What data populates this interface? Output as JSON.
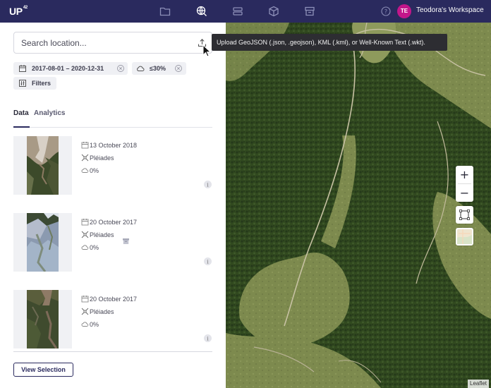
{
  "header": {
    "logo": "UP",
    "logo_sup": "42",
    "user_initials": "TE",
    "workspace": "Teodora's Workspace",
    "nav_icons": [
      "folder-icon",
      "globe-search-icon",
      "storage-icon",
      "cube-icon",
      "store-icon"
    ]
  },
  "search": {
    "placeholder": "Search location...",
    "tooltip": "Upload GeoJSON (.json, .geojson), KML (.kml), or Well-Known Text (.wkt)."
  },
  "filters": {
    "date_range": "2017-08-01 – 2020-12-31",
    "cloud": "≤30%",
    "filters_label": "Filters"
  },
  "tabs": [
    {
      "label": "Data",
      "active": true
    },
    {
      "label": "Analytics",
      "active": false
    }
  ],
  "results": [
    {
      "date": "13 October 2018",
      "sensor": "Pléiades",
      "cloud": "0%",
      "archived": false
    },
    {
      "date": "20 October 2017",
      "sensor": "Pléiades",
      "cloud": "0%",
      "archived": true
    },
    {
      "date": "20 October 2017",
      "sensor": "Pléiades",
      "cloud": "0%",
      "archived": false
    }
  ],
  "footer": {
    "view_selection": "View Selection"
  },
  "map": {
    "zoom_in": "+",
    "zoom_out": "−",
    "attribution": "Leaflet"
  },
  "colors": {
    "navbar": "#2a2a5e",
    "avatar": "#c3168a",
    "forest": "#2f4a22",
    "meadow": "#7d8a4e"
  }
}
